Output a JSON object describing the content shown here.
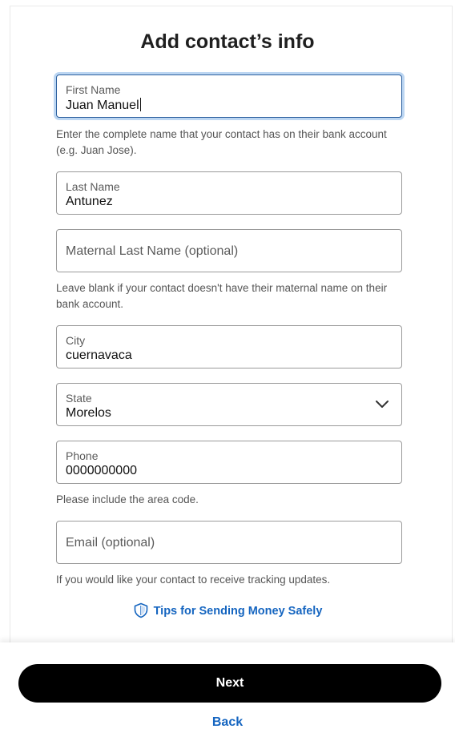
{
  "page": {
    "title": "Add contact’s info"
  },
  "form": {
    "first_name": {
      "label": "First Name",
      "value": "Juan Manuel"
    },
    "first_name_help": "Enter the complete name that your contact has on their bank account (e.g. Juan Jose).",
    "last_name": {
      "label": "Last Name",
      "value": "Antunez"
    },
    "maternal_last_name": {
      "placeholder": "Maternal Last Name (optional)"
    },
    "maternal_help": "Leave blank if your contact doesn't have their maternal name on their bank account.",
    "city": {
      "label": "City",
      "value": "cuernavaca"
    },
    "state": {
      "label": "State",
      "value": "Morelos"
    },
    "phone": {
      "label": "Phone",
      "value": "0000000000"
    },
    "phone_help": "Please include the area code.",
    "email": {
      "placeholder": "Email (optional)"
    },
    "email_help": "If you would like your contact to receive tracking updates."
  },
  "tips_link": {
    "label": "Tips for Sending Money Safely",
    "icon": "shield-icon"
  },
  "footer": {
    "next_label": "Next",
    "back_label": "Back"
  },
  "colors": {
    "link": "#1565c0",
    "focus_ring": "#bcd6f2",
    "primary_button": "#000000"
  }
}
